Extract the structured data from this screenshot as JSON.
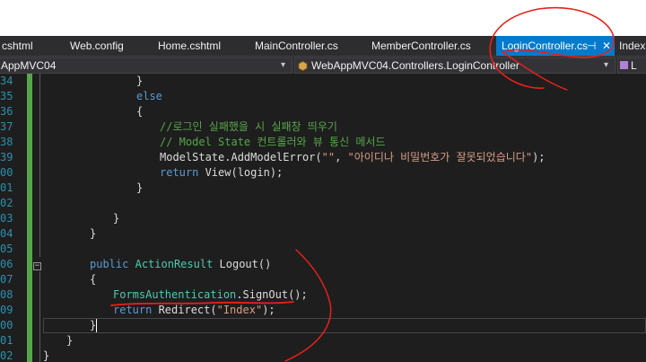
{
  "tabs": [
    {
      "label": "cshtml"
    },
    {
      "label": "Web.config"
    },
    {
      "label": "Home.cshtml"
    },
    {
      "label": "MainController.cs"
    },
    {
      "label": "MemberController.cs"
    },
    {
      "label": "LoginController.cs",
      "active": true,
      "pin_glyph": "⊣",
      "close_glyph": "✕"
    },
    {
      "label": "Index."
    }
  ],
  "nav": {
    "project": "AppMVC04",
    "class_path": "WebAppMVC04.Controllers.LoginController",
    "member": "L"
  },
  "line_numbers": [
    "34",
    "35",
    "36",
    "37",
    "38",
    "39",
    "00",
    "01",
    "02",
    "03",
    "04",
    "05",
    "06",
    "07",
    "08",
    "09",
    "00",
    "01",
    "02"
  ],
  "code": {
    "l1_brace": "}",
    "l2_else": "else",
    "l3_brace": "{",
    "l4_comment": "//로그인 실패했을 시 실패창 띄우기",
    "l5_comment": "// Model State 컨트롤러와 뷰 통신 메서드",
    "l6_a": "ModelState.AddModelError(",
    "l6_s1": "\"\"",
    "l6_b": ", ",
    "l6_s2": "\"아이디나 비밀번호가 잘못되었습니다\"",
    "l6_c": ");",
    "l7_kw": "return",
    "l7_rest": " View(login);",
    "l8_brace": "}",
    "l10_brace": "}",
    "l11_brace": "}",
    "l13_kw": "public",
    "l13_type": "ActionResult",
    "l13_rest": " Logout()",
    "l14_brace": "{",
    "l15_type": "FormsAuthentication",
    "l15_rest": ".SignOut();",
    "l16_kw": "return",
    "l16_a": " Redirect(",
    "l16_s": "\"Index\"",
    "l16_b": ");",
    "l17_brace": "}",
    "l18_brace": "}",
    "l19_brace": "}"
  },
  "colors": {
    "accent": "#007acc",
    "annotation": "#e8201c",
    "keyword": "#569cd6",
    "type": "#4ec9b0",
    "comment": "#57a64a",
    "string": "#d69d85"
  }
}
